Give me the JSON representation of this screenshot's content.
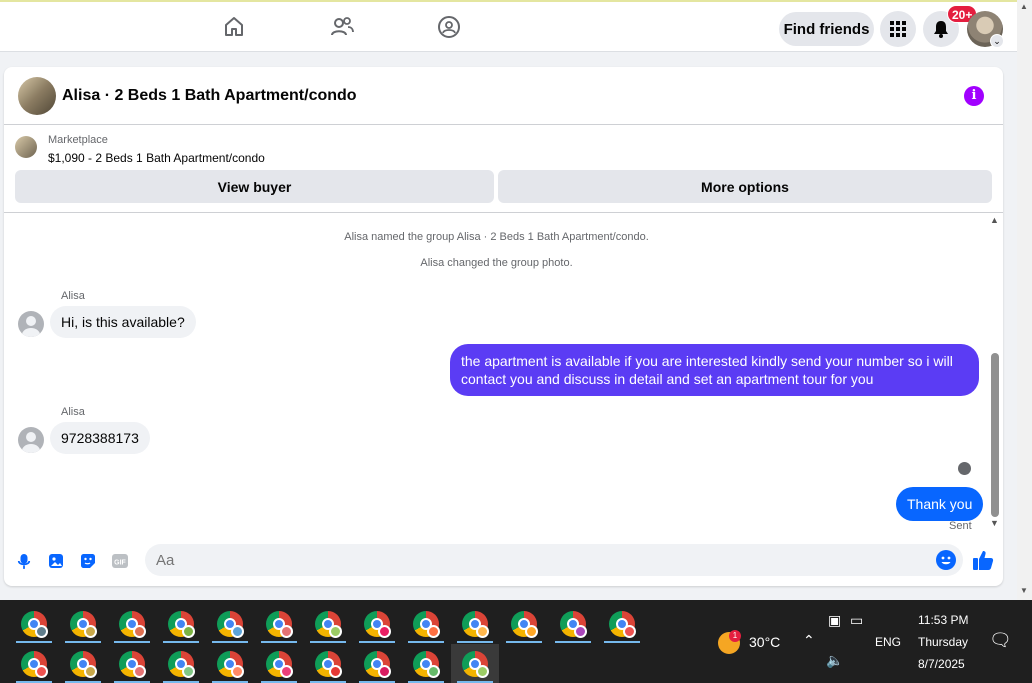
{
  "nav": {
    "find_friends_label": "Find friends",
    "notification_count": "20+"
  },
  "chat": {
    "title": "Alisa · 2 Beds 1 Bath Apartment/condo",
    "listing": {
      "source": "Marketplace",
      "title": "$1,090 - 2 Beds 1 Bath Apartment/condo"
    },
    "view_buyer_label": "View buyer",
    "more_options_label": "More options",
    "system_messages": [
      "Alisa named the group Alisa · 2 Beds 1 Bath Apartment/condo.",
      "Alisa changed the group photo."
    ],
    "messages": [
      {
        "sender": "Alisa",
        "text": "Hi, is this available?"
      },
      {
        "sender": "",
        "text": "the apartment is available if you are interested kindly send your number so i will contact you and discuss in detail and set an apartment tour for you"
      },
      {
        "sender": "Alisa",
        "text": "9728388173"
      },
      {
        "sender": "",
        "text": "Thank you"
      }
    ],
    "sent_status": "Sent",
    "input_placeholder": "Aa",
    "colors": {
      "outgoing_long": "#5b3cf4",
      "outgoing_short": "#0866ff",
      "info_accent": "#a100ff"
    }
  },
  "taskbar": {
    "temperature": "30°C",
    "weather_badge": "1",
    "language": "ENG",
    "time": "11:53 PM",
    "day": "Thursday",
    "date": "8/7/2025"
  }
}
